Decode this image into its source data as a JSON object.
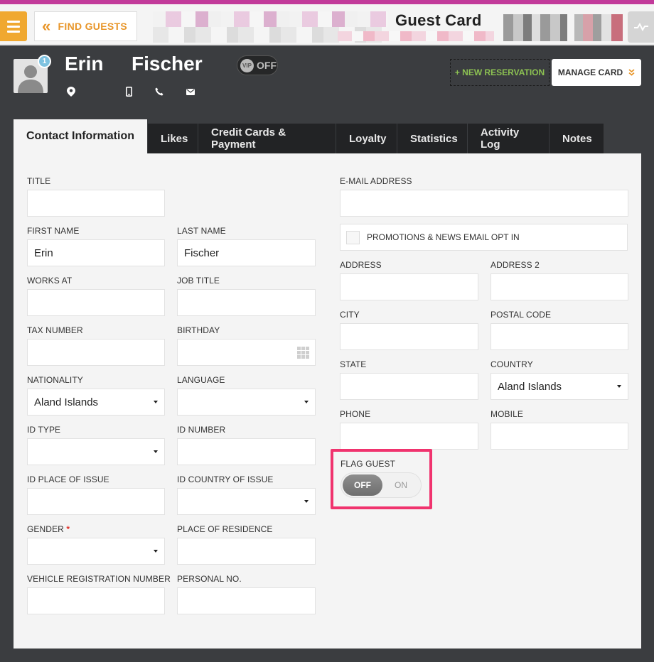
{
  "topbar": {
    "find_guests_label": "FIND GUESTS",
    "title": "Guest Card"
  },
  "guest": {
    "first_name": "Erin",
    "last_name": "Fischer",
    "badge_count": "1",
    "vip_badge": "VIP",
    "vip_state": "OFF",
    "icons": [
      "location-icon",
      "mobile-icon",
      "phone-icon",
      "email-icon"
    ]
  },
  "actions": {
    "new_reservation": "+ NEW RESERVATION",
    "manage_card": "MANAGE CARD"
  },
  "tabs": [
    {
      "label": "Contact Information",
      "active": true
    },
    {
      "label": "Likes"
    },
    {
      "label": "Credit Cards & Payment"
    },
    {
      "label": "Loyalty"
    },
    {
      "label": "Statistics"
    },
    {
      "label": "Activity Log"
    },
    {
      "label": "Notes"
    }
  ],
  "form": {
    "title": {
      "label": "TITLE",
      "value": ""
    },
    "first_name": {
      "label": "FIRST NAME",
      "value": "Erin"
    },
    "last_name": {
      "label": "LAST NAME",
      "value": "Fischer"
    },
    "works_at": {
      "label": "WORKS AT",
      "value": ""
    },
    "job_title": {
      "label": "JOB TITLE",
      "value": ""
    },
    "tax_number": {
      "label": "TAX NUMBER",
      "value": ""
    },
    "birthday": {
      "label": "BIRTHDAY",
      "value": ""
    },
    "nationality": {
      "label": "NATIONALITY",
      "value": "Aland Islands"
    },
    "language": {
      "label": "LANGUAGE",
      "value": ""
    },
    "id_type": {
      "label": "ID TYPE",
      "value": ""
    },
    "id_number": {
      "label": "ID NUMBER",
      "value": ""
    },
    "id_place": {
      "label": "ID PLACE OF ISSUE",
      "value": ""
    },
    "id_country": {
      "label": "ID COUNTRY OF ISSUE",
      "value": ""
    },
    "gender": {
      "label": "GENDER",
      "required_mark": "*",
      "value": ""
    },
    "place_of_residence": {
      "label": "PLACE OF RESIDENCE",
      "value": ""
    },
    "vehicle_reg": {
      "label": "VEHICLE REGISTRATION NUMBER",
      "value": ""
    },
    "personal_no": {
      "label": "PERSONAL NO.",
      "value": ""
    },
    "email": {
      "label": "E-MAIL ADDRESS",
      "value": ""
    },
    "promo_opt_in": {
      "label": "PROMOTIONS & NEWS EMAIL OPT IN",
      "checked": false
    },
    "address": {
      "label": "ADDRESS",
      "value": ""
    },
    "address2": {
      "label": "ADDRESS 2",
      "value": ""
    },
    "city": {
      "label": "CITY",
      "value": ""
    },
    "postal_code": {
      "label": "POSTAL CODE",
      "value": ""
    },
    "state": {
      "label": "STATE",
      "value": ""
    },
    "country": {
      "label": "COUNTRY",
      "value": "Aland Islands"
    },
    "phone": {
      "label": "PHONE",
      "value": ""
    },
    "mobile": {
      "label": "MOBILE",
      "value": ""
    },
    "flag_guest": {
      "label": "FLAG GUEST",
      "off_label": "OFF",
      "on_label": "ON",
      "state": "OFF"
    }
  },
  "colors": {
    "accent_orange": "#f0a830",
    "highlight_pink": "#f0336e",
    "new_res_green": "#8cc152",
    "header_dark": "#3b3d40"
  }
}
